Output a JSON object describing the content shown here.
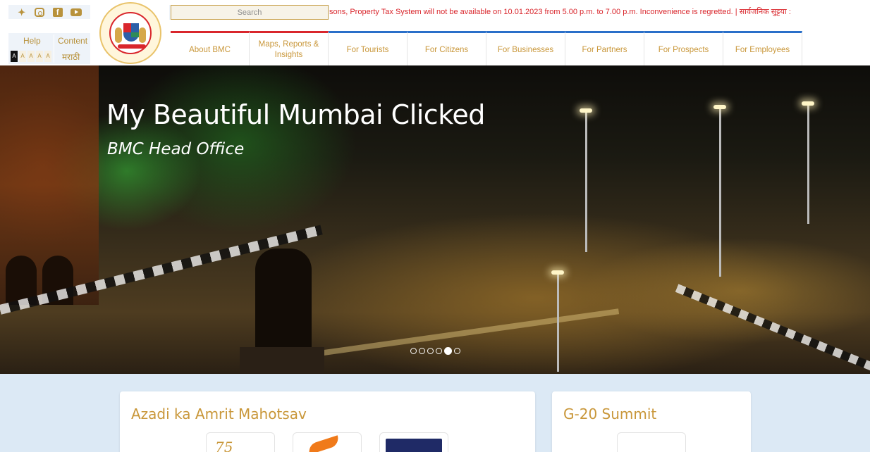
{
  "header": {
    "social_icons": [
      "twitter-icon",
      "instagram-icon",
      "facebook-icon",
      "youtube-icon"
    ],
    "utility": {
      "help_label": "Help",
      "content_label": "Content",
      "font_size_labels": [
        "A",
        "A",
        "A",
        "A",
        "A"
      ],
      "language_label": "मराठी"
    },
    "search": {
      "placeholder": "Search"
    },
    "ticker_text": "sons, Property Tax System will not be available on 10.01.2023 from 5.00 p.m. to 7.00 p.m. Inconvenience is regretted. | सार्वजनिक सुट्टया :",
    "nav": [
      {
        "label": "About BMC"
      },
      {
        "label": "Maps, Reports & Insights"
      },
      {
        "label": "For Tourists"
      },
      {
        "label": "For Citizens"
      },
      {
        "label": "For Businesses"
      },
      {
        "label": "For Partners"
      },
      {
        "label": "For Prospects"
      },
      {
        "label": "For Employees"
      }
    ]
  },
  "hero": {
    "title": "My Beautiful Mumbai Clicked",
    "subtitle": "BMC Head Office",
    "slides_count": 6,
    "active_slide": 5
  },
  "cards": [
    {
      "title": "Azadi ka Amrit Mahotsav"
    },
    {
      "title": "G-20 Summit"
    }
  ],
  "colors": {
    "gold": "#c9973a",
    "ticker_red": "#d9262c",
    "nav_blue": "#2a6fc9",
    "page_bg": "#dce9f5"
  }
}
